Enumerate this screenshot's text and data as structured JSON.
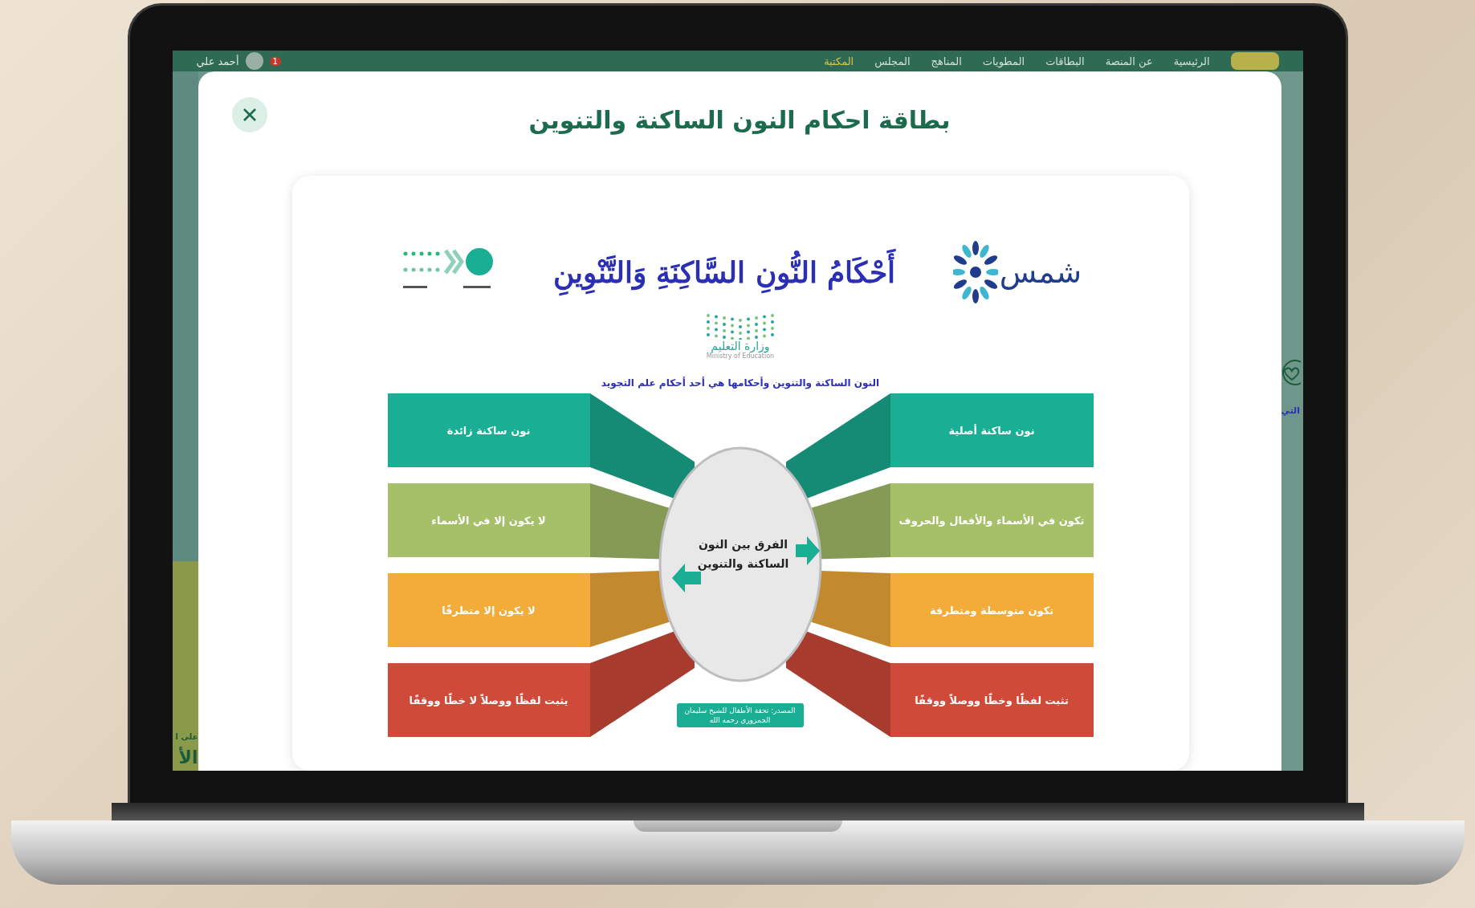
{
  "nav": {
    "items": [
      {
        "label": "الرئيسية",
        "selected": false
      },
      {
        "label": "عن المنصة",
        "selected": false
      },
      {
        "label": "البطاقات",
        "selected": false
      },
      {
        "label": "المطويات",
        "selected": false
      },
      {
        "label": "المناهج",
        "selected": false
      },
      {
        "label": "المجلس",
        "selected": false
      },
      {
        "label": "المكتبة",
        "selected": true
      }
    ],
    "notification_count": "1",
    "user_name": "أحمد علي"
  },
  "side_texts": {
    "left": [
      "على ا",
      "الأ"
    ],
    "right": [
      "التي"
    ]
  },
  "modal": {
    "title": "بطاقة احكام النون الساكنة والتنوين",
    "card": {
      "logo_text": "شمس",
      "title": "أَحْكَامُ النُّونِ السَّاكِنَةِ وَالتَّنْوِينِ",
      "ministry": {
        "name_ar": "وزارة التعليم",
        "name_en": "Ministry of Education"
      },
      "subtitle": "النون الساكنة والتنوين وأحكامها هي أحد أحكام علم التجويد",
      "diagram": {
        "center": "الفرق بين النون الساكنة والتنوين",
        "right": [
          {
            "text": "نون ساكنة أصلية",
            "color": "#1aae94"
          },
          {
            "text": "تكون في الأسماء والأفعال والحروف",
            "color": "#a6c06a"
          },
          {
            "text": "تكون متوسطة ومتطرفة",
            "color": "#f3ab3a"
          },
          {
            "text": "تثبت لفظًا وخطًا ووصلاً ووقفًا",
            "color": "#d04a3a"
          }
        ],
        "left": [
          {
            "text": "نون ساكنة زائدة",
            "color": "#1aae94"
          },
          {
            "text": "لا يكون إلا في الأسماء",
            "color": "#a6c06a"
          },
          {
            "text": "لا يكون إلا متطرفًا",
            "color": "#f3ab3a"
          },
          {
            "text": "يثبت لفظًا ووصلاً لا خطًا ووقفًا",
            "color": "#d04a3a"
          }
        ],
        "source": "المصدر: تحفة الأطفال للشيخ سليمان الجمزوري رحمه الله"
      }
    }
  }
}
